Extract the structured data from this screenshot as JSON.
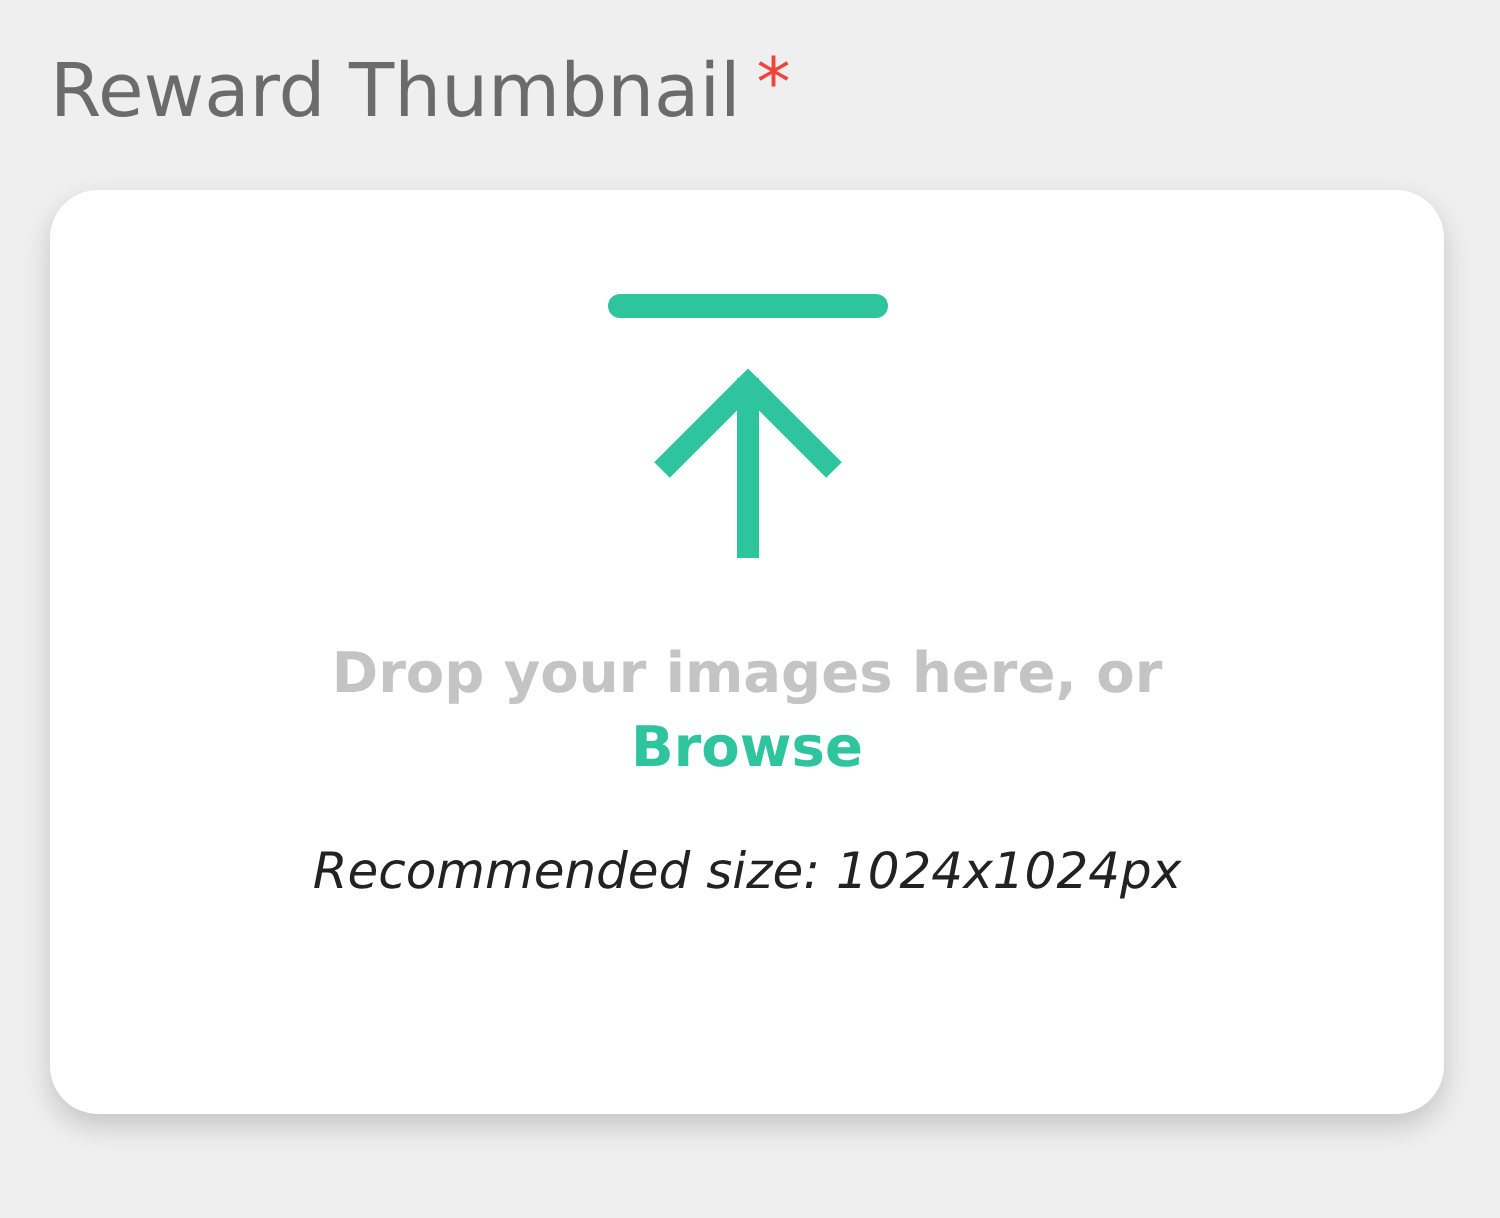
{
  "field": {
    "label": "Reward Thumbnail",
    "required_mark": "*"
  },
  "dropzone": {
    "prompt": "Drop your images here, or",
    "link": "Browse",
    "hint": "Recommended size: 1024x1024px"
  }
}
